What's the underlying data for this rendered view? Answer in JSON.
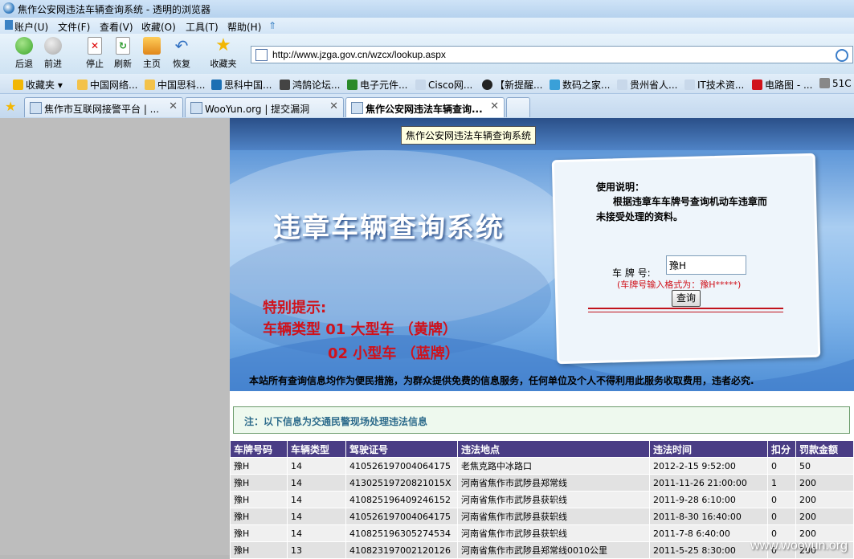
{
  "window": {
    "title": "焦作公安网违法车辆查询系统 - 透明的浏览器"
  },
  "menu": [
    "账户(U)",
    "文件(F)",
    "查看(V)",
    "收藏(O)",
    "工具(T)",
    "帮助(H)"
  ],
  "toolbar": {
    "back": "后退",
    "forward": "前进",
    "stop": "停止",
    "refresh": "刷新",
    "home": "主页",
    "restore": "恢复",
    "favorites": "收藏夹"
  },
  "address": {
    "url": "http://www.jzga.gov.cn/wzcx/lookup.aspx"
  },
  "favbar": {
    "label": "收藏夹",
    "items": [
      "中国网络...",
      "中国思科...",
      "思科中国...",
      "鸿鹄论坛...",
      "电子元件...",
      "Cisco网...",
      "【新提醒...",
      "数码之家...",
      "贵州省人...",
      "IT技术资...",
      "电路图 - ...",
      "51C"
    ]
  },
  "tabs": [
    {
      "label": "焦作市互联网接警平台 | ..."
    },
    {
      "label": "WooYun.org | 提交漏洞"
    },
    {
      "label": "焦作公安网违法车辆查询..."
    }
  ],
  "tooltip": "焦作公安网违法车辆查询系统",
  "banner": {
    "title": "违章车辆查询系统",
    "tip_heading": "特别提示:",
    "tip_line1": "车辆类型  01 大型车 （黄牌）",
    "tip_line2": "02 小型车 （蓝牌）",
    "notice": "本站所有查询信息均作为便民措施，为群众提供免费的信息服务，任何单位及个人不得利用此服务收取费用，违者必究."
  },
  "panel": {
    "usage_title": "使用说明：",
    "usage_line1": "根据违章车车牌号查询机动车违章而",
    "usage_line2": "未接受处理的资料。",
    "plate_label": "车 牌 号:",
    "plate_value": "豫H",
    "format_hint": "(车牌号输入格式为：豫H*****)",
    "query_button": "查询"
  },
  "info": "注：以下信息为交通民警现场处理违法信息",
  "table": {
    "headers": [
      "车牌号码",
      "车辆类型",
      "驾驶证号",
      "违法地点",
      "违法时间",
      "扣分",
      "罚款金额"
    ],
    "rows": [
      [
        "豫H",
        "14",
        "410526197004064175",
        "老焦克路中冰路口",
        "2012-2-15 9:52:00",
        "0",
        "50"
      ],
      [
        "豫H",
        "14",
        "41302519720821015X",
        "河南省焦作市武陟县郑常线",
        "2011-11-26 21:00:00",
        "1",
        "200"
      ],
      [
        "豫H",
        "14",
        "410825196409246152",
        "河南省焦作市武陟县获轵线",
        "2011-9-28 6:10:00",
        "0",
        "200"
      ],
      [
        "豫H",
        "14",
        "410526197004064175",
        "河南省焦作市武陟县获轵线",
        "2011-8-30 16:40:00",
        "0",
        "200"
      ],
      [
        "豫H",
        "14",
        "410825196305274534",
        "河南省焦作市武陟县获轵线",
        "2011-7-8 6:40:00",
        "0",
        "200"
      ],
      [
        "豫H",
        "13",
        "410823197002120126",
        "河南省焦作市武陟县郑常线0010公里",
        "2011-5-25 8:30:00",
        "0",
        "200"
      ]
    ]
  },
  "watermark": "www.wooyun.org"
}
